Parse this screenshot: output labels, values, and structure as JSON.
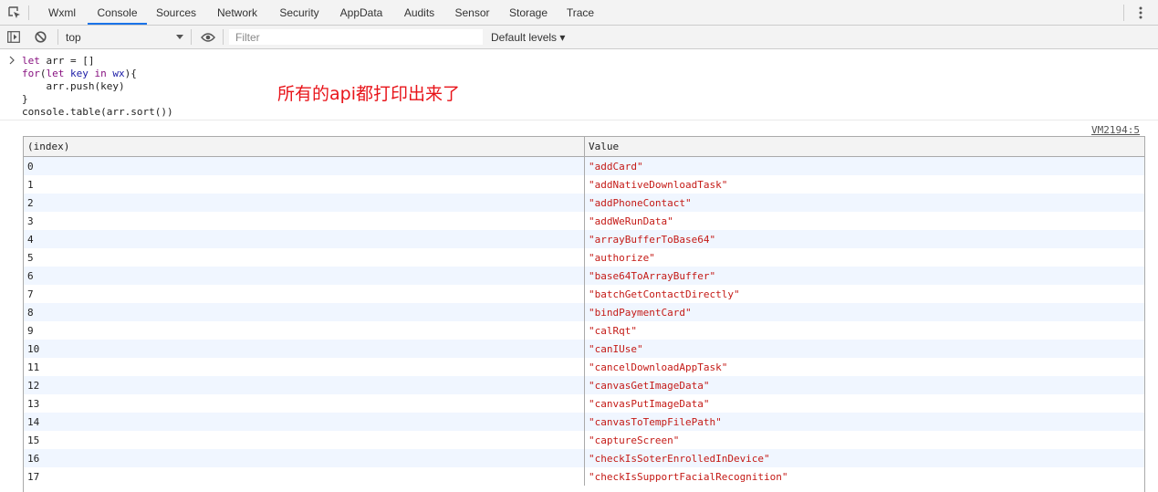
{
  "tabs": [
    "Wxml",
    "Console",
    "Sources",
    "Network",
    "Security",
    "AppData",
    "Audits",
    "Sensor",
    "Storage",
    "Trace"
  ],
  "active_tab": "Console",
  "toolbar": {
    "context": "top",
    "filter_placeholder": "Filter",
    "levels": "Default levels ▾"
  },
  "console": {
    "code": {
      "l1a": "let",
      "l1b": " arr = []",
      "l2a": "for",
      "l2b": "(",
      "l2c": "let",
      "l2d": " ",
      "l2e": "key",
      "l2f": " ",
      "l2g": "in",
      "l2h": " ",
      "l2i": "wx",
      "l2j": "){",
      "l3": "    arr.push(key)",
      "l4": "}",
      "l5": "console.table(arr.sort())"
    },
    "annotation": "所有的api都打印出来了",
    "source_link": "VM2194:5"
  },
  "table": {
    "headers": [
      "(index)",
      "Value"
    ],
    "rows": [
      [
        "0",
        "\"addCard\""
      ],
      [
        "1",
        "\"addNativeDownloadTask\""
      ],
      [
        "2",
        "\"addPhoneContact\""
      ],
      [
        "3",
        "\"addWeRunData\""
      ],
      [
        "4",
        "\"arrayBufferToBase64\""
      ],
      [
        "5",
        "\"authorize\""
      ],
      [
        "6",
        "\"base64ToArrayBuffer\""
      ],
      [
        "7",
        "\"batchGetContactDirectly\""
      ],
      [
        "8",
        "\"bindPaymentCard\""
      ],
      [
        "9",
        "\"calRqt\""
      ],
      [
        "10",
        "\"canIUse\""
      ],
      [
        "11",
        "\"cancelDownloadAppTask\""
      ],
      [
        "12",
        "\"canvasGetImageData\""
      ],
      [
        "13",
        "\"canvasPutImageData\""
      ],
      [
        "14",
        "\"canvasToTempFilePath\""
      ],
      [
        "15",
        "\"captureScreen\""
      ],
      [
        "16",
        "\"checkIsSoterEnrolledInDevice\""
      ],
      [
        "17",
        "\"checkIsSupportFacialRecognition\""
      ]
    ]
  },
  "colors": {
    "active_tab_underline": "#1a73e8",
    "annotation": "#e8141a",
    "string_value": "#c41a16",
    "keyword": "#881280"
  }
}
